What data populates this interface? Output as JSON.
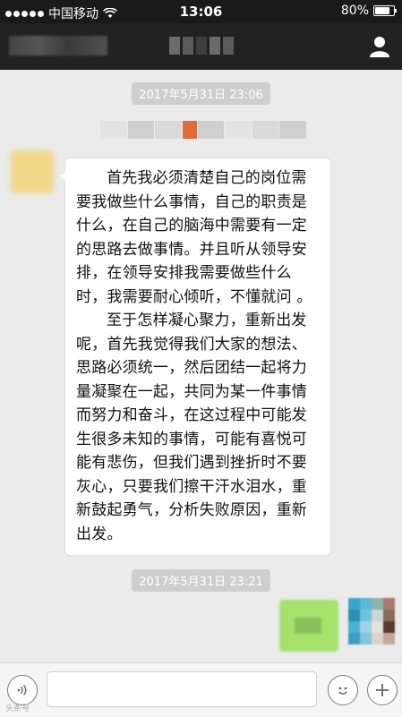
{
  "status_bar": {
    "carrier": "中国移动",
    "time": "13:06",
    "battery": "80%",
    "battery_level": 0.8,
    "signal_icon": "signal-dots-icon",
    "wifi_icon": "wifi-icon"
  },
  "nav": {
    "profile_icon": "person-icon"
  },
  "messages": {
    "timestamp_1": "2017年5月31日 23:06",
    "incoming_paragraph_1": "首先我必须清楚自己的岗位需要我做些什么事情，自己的职责是什么，在自己的脑海中需要有一定的思路去做事情。并且听从领导安排，在领导安排我需要做些什么时，我需要耐心倾听，不懂就问 。",
    "incoming_paragraph_2": "至于怎样凝心聚力，重新出发呢，首先我觉得我们大家的想法、思路必须统一，然后团结一起将力量凝聚在一起，共同为某一件事情而努力和奋斗，在这过程中可能发生很多未知的事情，可能有喜悦可能有悲伤，但我们遇到挫折时不要灰心，只要我们擦干汗水泪水，重新鼓起勇气，分析失败原因，重新出发。",
    "timestamp_2": "2017年5月31日 23:21"
  },
  "input_bar": {
    "voice_icon": "voice-icon",
    "emoji_icon": "emoji-icon",
    "add_icon": "plus-icon",
    "watermark": "头条号"
  }
}
